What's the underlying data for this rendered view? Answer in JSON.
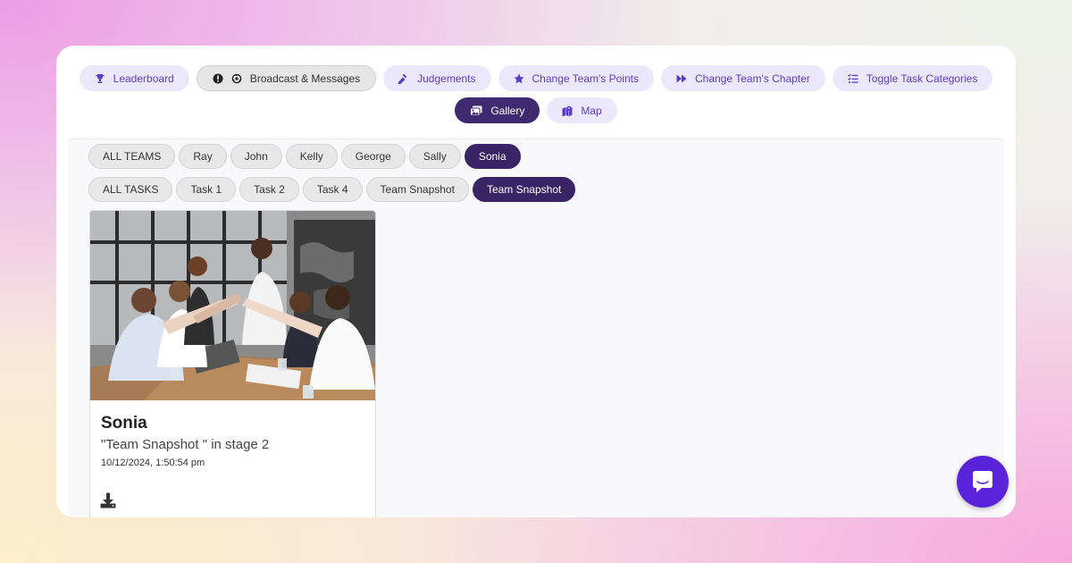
{
  "nav": {
    "row1": [
      {
        "label": "Leaderboard",
        "icon": "trophy-icon"
      },
      {
        "label": "Broadcast & Messages",
        "icon": "broadcast-icon"
      },
      {
        "label": "Judgements",
        "icon": "gavel-icon"
      },
      {
        "label": "Change Team's Points",
        "icon": "star-icon"
      },
      {
        "label": "Change Team's Chapter",
        "icon": "fast-forward-icon"
      },
      {
        "label": "Toggle Task Categories",
        "icon": "checklist-icon"
      }
    ],
    "row2": [
      {
        "label": "Gallery",
        "icon": "images-icon",
        "active": true
      },
      {
        "label": "Map",
        "icon": "map-icon"
      }
    ]
  },
  "filters": {
    "teams": [
      "ALL TEAMS",
      "Ray",
      "John",
      "Kelly",
      "George",
      "Sally",
      "Sonia"
    ],
    "selected_team": "Sonia",
    "tasks": [
      "ALL TASKS",
      "Task 1",
      "Task 2",
      "Task 4",
      "Team Snapshot",
      "Team Snapshot"
    ],
    "selected_task_index": 5
  },
  "gallery": {
    "items": [
      {
        "team": "Sonia",
        "description": "\"Team Snapshot \" in stage 2",
        "timestamp": "10/12/2024, 1:50:54 pm",
        "image": "photo of a team giving high fives at a meeting table",
        "icon": "download-icon"
      }
    ]
  },
  "chat": {
    "icon": "chat-bubble-icon"
  },
  "colors": {
    "accent": "#5b3cc4",
    "active": "#3f2a72",
    "chat": "#5b23d9",
    "chip_active": "#3a2466"
  }
}
